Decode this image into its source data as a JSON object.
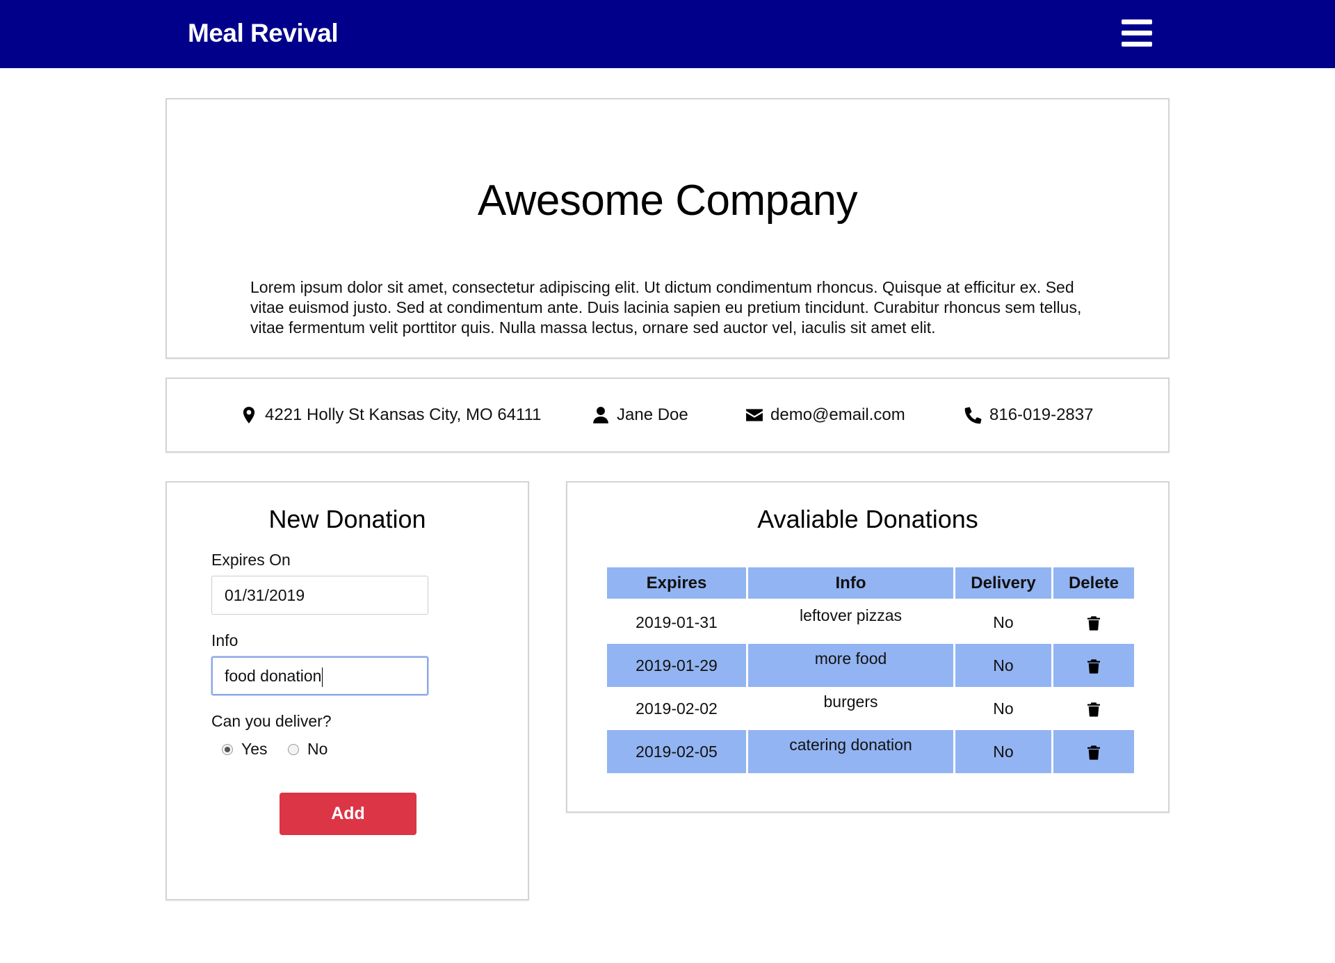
{
  "navbar": {
    "brand": "Meal Revival",
    "menu_icon": "hamburger-menu-icon",
    "background": "#00008b"
  },
  "company": {
    "name": "Awesome Company",
    "description": "Lorem ipsum dolor sit amet, consectetur adipiscing elit. Ut dictum condimentum rhoncus. Quisque at efficitur ex. Sed vitae euismod justo. Sed at condimentum ante. Duis lacinia sapien eu pretium tincidunt. Curabitur rhoncus sem tellus, vitae fermentum velit porttitor quis. Nulla massa lectus, ornare sed auctor vel, iaculis sit amet elit."
  },
  "contact": {
    "address": "4221 Holly St Kansas City, MO 64111",
    "name": "Jane Doe",
    "email": "demo@email.com",
    "phone": "816-019-2837",
    "icons": [
      "map-marker-icon",
      "user-icon",
      "envelope-icon",
      "phone-icon"
    ]
  },
  "new_donation": {
    "title": "New Donation",
    "expires_label": "Expires On",
    "expires_value": "01/31/2019",
    "info_label": "Info",
    "info_value": "food donation",
    "deliver_label": "Can you deliver?",
    "yes_label": "Yes",
    "no_label": "No",
    "deliver_selected": "Yes",
    "add_label": "Add",
    "add_color": "#dc3545"
  },
  "available": {
    "title": "Avaliable Donations",
    "headers": [
      "Expires",
      "Info",
      "Delivery",
      "Delete"
    ],
    "header_color": "#93b4f2",
    "rows": [
      {
        "expires": "2019-01-31",
        "info": "leftover pizzas",
        "delivery": "No"
      },
      {
        "expires": "2019-01-29",
        "info": "more food",
        "delivery": "No"
      },
      {
        "expires": "2019-02-02",
        "info": "burgers",
        "delivery": "No"
      },
      {
        "expires": "2019-02-05",
        "info": "catering donation",
        "delivery": "No"
      }
    ],
    "delete_icon": "trash-icon"
  }
}
